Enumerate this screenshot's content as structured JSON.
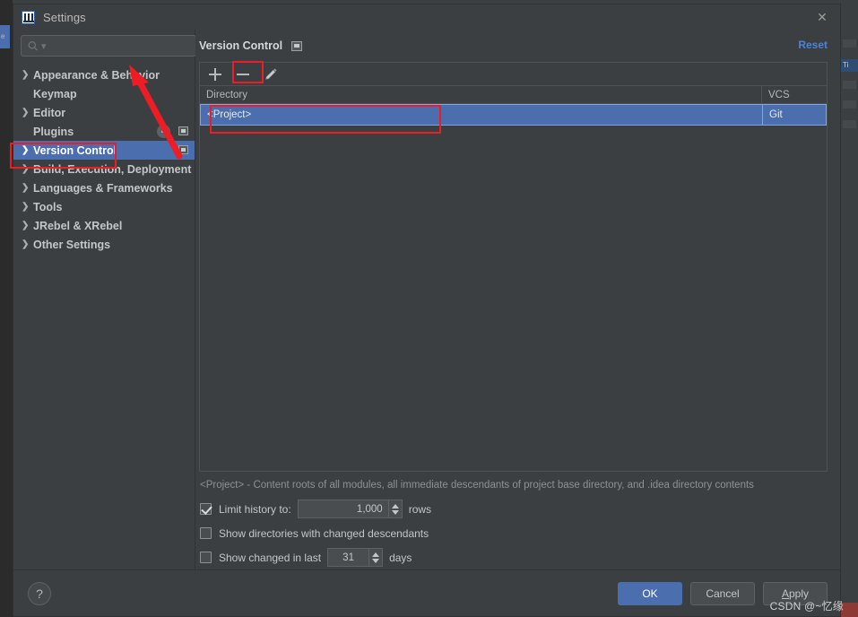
{
  "window": {
    "title": "Settings",
    "app_icon": "intellij-idea-icon",
    "close_icon": "close-icon"
  },
  "search": {
    "placeholder": "",
    "value": "",
    "icon": "search-icon"
  },
  "sidebar": {
    "items": [
      {
        "label": "Appearance & Behavior",
        "expandable": true,
        "selected": false,
        "badge": "",
        "mini_icon": false
      },
      {
        "label": "Keymap",
        "expandable": false,
        "selected": false,
        "badge": "",
        "mini_icon": false
      },
      {
        "label": "Editor",
        "expandable": true,
        "selected": false,
        "badge": "",
        "mini_icon": false
      },
      {
        "label": "Plugins",
        "expandable": false,
        "selected": false,
        "badge": "4",
        "mini_icon": true
      },
      {
        "label": "Version Control",
        "expandable": true,
        "selected": true,
        "badge": "",
        "mini_icon": true
      },
      {
        "label": "Build, Execution, Deployment",
        "expandable": true,
        "selected": false,
        "badge": "",
        "mini_icon": false
      },
      {
        "label": "Languages & Frameworks",
        "expandable": true,
        "selected": false,
        "badge": "",
        "mini_icon": false
      },
      {
        "label": "Tools",
        "expandable": true,
        "selected": false,
        "badge": "",
        "mini_icon": false
      },
      {
        "label": "JRebel & XRebel",
        "expandable": true,
        "selected": false,
        "badge": "",
        "mini_icon": false
      },
      {
        "label": "Other Settings",
        "expandable": true,
        "selected": false,
        "badge": "",
        "mini_icon": false
      }
    ]
  },
  "main": {
    "section_title": "Version Control",
    "section_title_icon": "config-scope-icon",
    "reset_label": "Reset",
    "toolbar": {
      "add_label": "+",
      "remove_label": "−",
      "edit_label": "edit",
      "add_icon": "plus-icon",
      "remove_icon": "minus-icon",
      "edit_icon": "pencil-icon"
    },
    "table": {
      "columns": [
        "Directory",
        "VCS"
      ],
      "rows": [
        {
          "directory": "<Project>",
          "vcs": "Git",
          "selected": true
        }
      ]
    },
    "description": "<Project> - Content roots of all modules, all immediate descendants of project base directory, and .idea directory contents",
    "options": [
      {
        "id": "limit-history",
        "label": "Limit history to:",
        "checked": true,
        "spinner_value": "1,000",
        "suffix": "rows"
      },
      {
        "id": "show-directories-changed-descendants",
        "label": "Show directories with changed descendants",
        "checked": false,
        "spinner_value": "",
        "suffix": ""
      },
      {
        "id": "show-changed-in-last",
        "label": "Show changed in last",
        "checked": false,
        "spinner_value": "31",
        "suffix": "days"
      }
    ]
  },
  "footer": {
    "help_label": "?",
    "ok_label": "OK",
    "cancel_label": "Cancel",
    "apply_label_before": "A",
    "apply_label_after": "pply"
  },
  "watermark": "CSDN @~忆缘",
  "background": {
    "left_tab_label": "e",
    "right_selected_label": "Ti"
  },
  "colors": {
    "dialog_bg": "#3c3f41",
    "selection_blue": "#4b6eaf",
    "accent_link": "#4b83d8",
    "annotation_red": "#ee1c25",
    "text_primary": "#c3c6c9",
    "text_muted": "#8d9194"
  }
}
